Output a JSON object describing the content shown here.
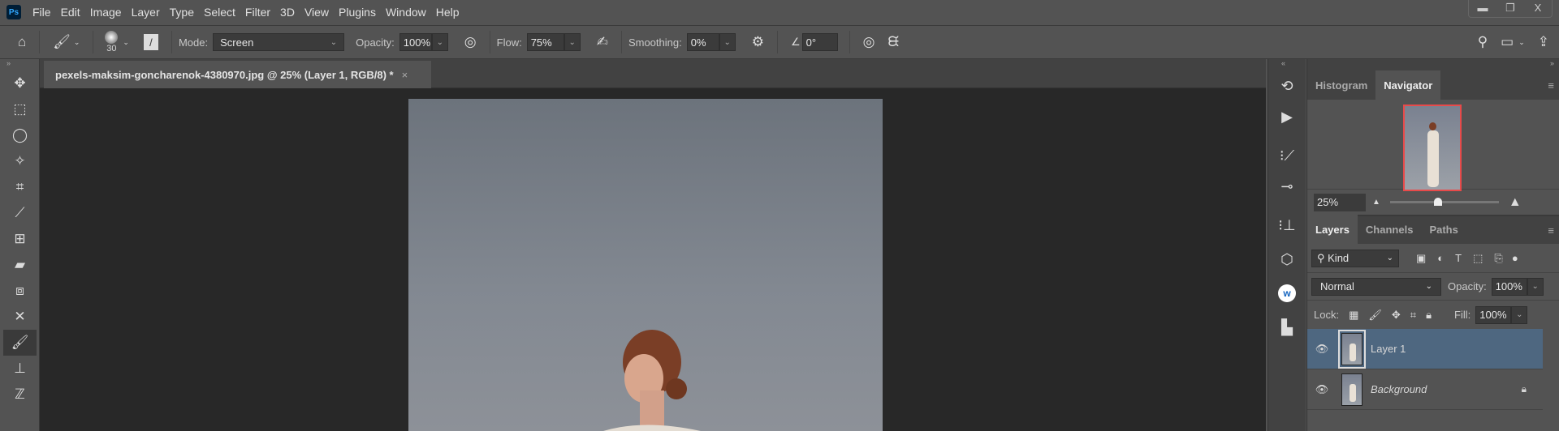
{
  "menubar": {
    "logo": "Ps",
    "items": [
      "File",
      "Edit",
      "Image",
      "Layer",
      "Type",
      "Select",
      "Filter",
      "3D",
      "View",
      "Plugins",
      "Window",
      "Help"
    ],
    "window_buttons": [
      "minimize",
      "restore",
      "X"
    ]
  },
  "options": {
    "brush_size": "30",
    "mode_label": "Mode:",
    "mode_value": "Screen",
    "opacity_label": "Opacity:",
    "opacity_value": "100%",
    "flow_label": "Flow:",
    "flow_value": "75%",
    "smoothing_label": "Smoothing:",
    "smoothing_value": "0%",
    "angle_value": "0°"
  },
  "document": {
    "tab_title": "pexels-maksim-goncharenok-4380970.jpg @ 25% (Layer 1, RGB/8) *",
    "close": "×"
  },
  "navigator": {
    "tabs": [
      "Histogram",
      "Navigator"
    ],
    "zoom": "25%",
    "zoom_slider_fraction": 0.4
  },
  "layers": {
    "tabs": [
      "Layers",
      "Channels",
      "Paths"
    ],
    "filter_kind": "Kind",
    "blend_mode": "Normal",
    "opacity_label": "Opacity:",
    "opacity": "100%",
    "lock_label": "Lock:",
    "fill_label": "Fill:",
    "fill": "100%",
    "items": [
      {
        "name": "Layer 1",
        "selected": true
      },
      {
        "name": "Background",
        "locked": true
      }
    ]
  },
  "colors": {
    "accent_selected": "#4e6780",
    "nav_box": "#e84a4a"
  }
}
